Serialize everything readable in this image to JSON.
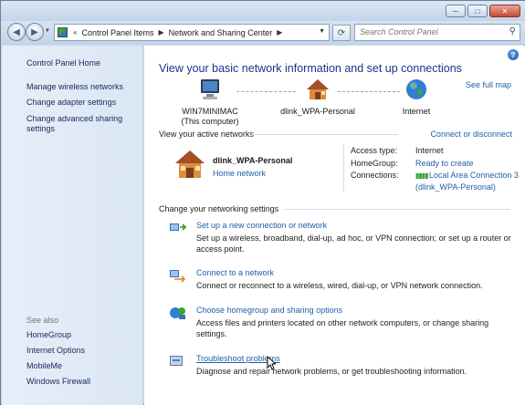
{
  "window": {
    "controls": {
      "minimize": "─",
      "maximize": "□",
      "close": "✕"
    }
  },
  "nav": {
    "back_glyph": "◀",
    "forward_glyph": "▶",
    "crumb_prefix": "«",
    "breadcrumbs": [
      "Control Panel Items",
      "Network and Sharing Center"
    ],
    "crumb_separator": "▶",
    "refresh_glyph": "⟳",
    "search_placeholder": "Search Control Panel",
    "search_glyph": "⚲"
  },
  "left_pane": {
    "home": "Control Panel Home",
    "tasks": [
      "Manage wireless networks",
      "Change adapter settings",
      "Change advanced sharing settings"
    ],
    "see_also_label": "See also",
    "see_also": [
      "HomeGroup",
      "Internet Options",
      "MobileMe",
      "Windows Firewall"
    ]
  },
  "main": {
    "help_glyph": "?",
    "heading": "View your basic network information and set up connections",
    "see_full_map": "See full map",
    "map": {
      "computer": {
        "name": "WIN7MINIMAC",
        "sub": "(This computer)",
        "icon": "computer-icon"
      },
      "network": {
        "name": "dlink_WPA-Personal",
        "icon": "house-icon"
      },
      "internet": {
        "name": "Internet",
        "icon": "globe-icon"
      }
    },
    "active_networks_title": "View your active networks",
    "connect_or_disconnect": "Connect or disconnect",
    "active_network": {
      "name": "dlink_WPA-Personal",
      "type_link": "Home network",
      "access_type_label": "Access type:",
      "access_type_value": "Internet",
      "homegroup_label": "HomeGroup:",
      "homegroup_value": "Ready to create",
      "connections_label": "Connections:",
      "connection_line1": "Local Area Connection 3",
      "connection_line2": "(dlink_WPA-Personal)"
    },
    "settings_title": "Change your networking settings",
    "tasks": [
      {
        "title": "Set up a new connection or network",
        "desc": "Set up a wireless, broadband, dial-up, ad hoc, or VPN connection; or set up a router or access point.",
        "icon": "new-connection-icon"
      },
      {
        "title": "Connect to a network",
        "desc": "Connect or reconnect to a wireless, wired, dial-up, or VPN network connection.",
        "icon": "connect-network-icon"
      },
      {
        "title": "Choose homegroup and sharing options",
        "desc": "Access files and printers located on other network computers, or change sharing settings.",
        "icon": "homegroup-icon"
      },
      {
        "title": "Troubleshoot problems",
        "desc": "Diagnose and repair network problems, or get troubleshooting information.",
        "icon": "troubleshoot-icon"
      }
    ]
  },
  "colors": {
    "link": "#1f5fa6",
    "heading": "#1e3287",
    "left_pane_link": "#142a55"
  }
}
